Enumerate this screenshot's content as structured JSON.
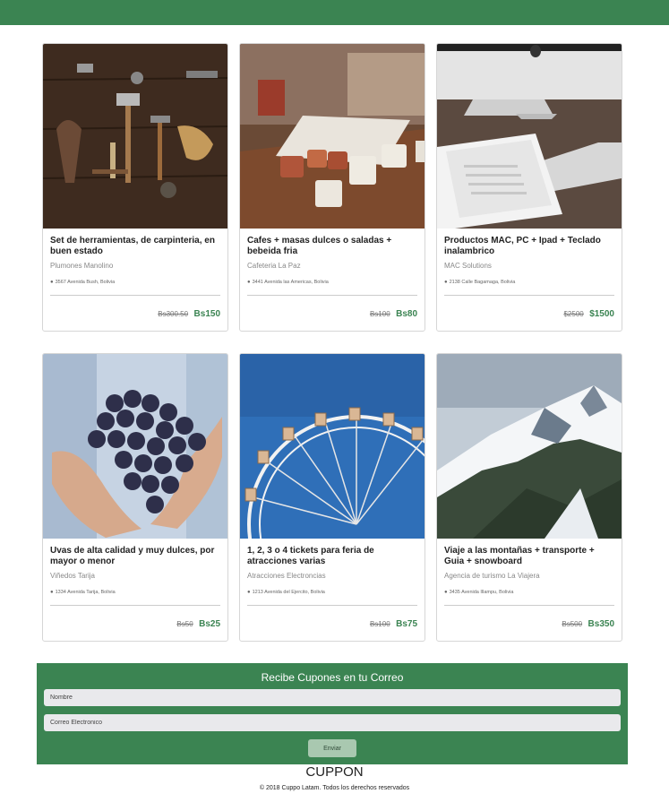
{
  "colors": {
    "brand_green": "#3b8452",
    "price_green": "#3b8452",
    "button_light": "#a9c8b0"
  },
  "products": [
    {
      "title": "Set de herramientas, de carpinteria, en buen estado",
      "vendor": "Plumones Manolino",
      "address": "3567 Avenida Bush, Bolivia",
      "old_price": "Bs300.50",
      "new_price": "Bs150",
      "image": "carpentry-tools-photo"
    },
    {
      "title": "Cafes + masas dulces o saladas + bebeida fria",
      "vendor": "Cafeteria La Paz",
      "address": "3441 Avenida las Americas, Bolivia",
      "old_price": "Bs100",
      "new_price": "Bs80",
      "image": "coffee-cups-photo"
    },
    {
      "title": "Productos MAC, PC + Ipad + Teclado inalambrico",
      "vendor": "MAC Solutions",
      "address": "2138 Calle Bagamaga, Bolivia",
      "old_price": "$2500",
      "new_price": "$1500",
      "image": "mac-ipad-keyboard-photo"
    },
    {
      "title": "Uvas de alta calidad y muy dulces, por mayor o menor",
      "vendor": "Viñedos Tarija",
      "address": "1334 Avenida Tarija, Bolivia",
      "old_price": "Bs50",
      "new_price": "Bs25",
      "image": "grapes-photo"
    },
    {
      "title": "1, 2, 3 o 4 tickets para feria de atracciones varias",
      "vendor": "Atracciones Electroncias",
      "address": "1213 Avenida del Ejercito, Bolivia",
      "old_price": "Bs100",
      "new_price": "Bs75",
      "image": "ferris-wheel-photo"
    },
    {
      "title": "Viaje a las montañas + transporte + Guia + snowboard",
      "vendor": "Agencia de turismo La Viajera",
      "address": "3435 Avenida Illampu, Bolivia",
      "old_price": "Bs500",
      "new_price": "Bs350",
      "image": "snowy-mountain-photo"
    }
  ],
  "newsletter": {
    "title": "Recibe Cupones en tu Correo",
    "name_placeholder": "Nombre",
    "email_placeholder": "Correo Electronico",
    "submit_label": "Enviar"
  },
  "footer": {
    "brand": "CUPPON",
    "copyright": "© 2018 Cuppo Latam. Todos los derechos reservados"
  }
}
